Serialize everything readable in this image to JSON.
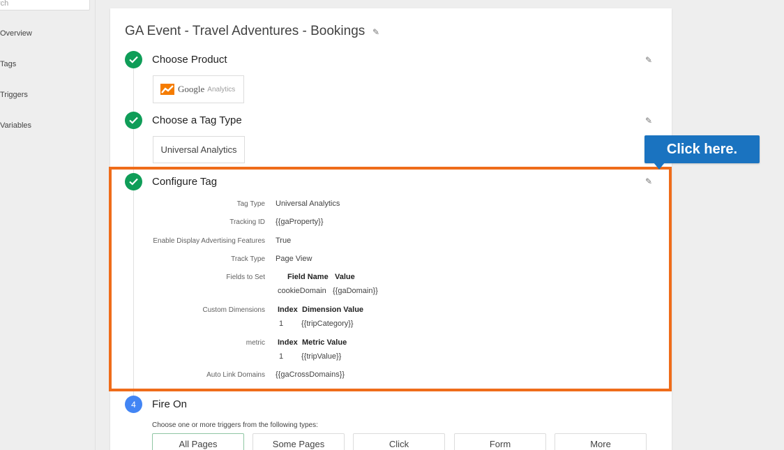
{
  "sidebar": {
    "search_placeholder": "rch",
    "items": [
      {
        "label": "Overview"
      },
      {
        "label": "Tags"
      },
      {
        "label": "Triggers"
      },
      {
        "label": "Variables"
      }
    ]
  },
  "tag": {
    "title": "GA Event - Travel Adventures - Bookings"
  },
  "steps": {
    "choose_product": {
      "label": "Choose Product",
      "product_google": "Google",
      "product_analytics": "Analytics"
    },
    "choose_tag_type": {
      "label": "Choose a Tag Type",
      "value": "Universal Analytics"
    },
    "configure_tag": {
      "label": "Configure Tag",
      "rows": {
        "tag_type": {
          "label": "Tag Type",
          "value": "Universal Analytics"
        },
        "tracking_id": {
          "label": "Tracking ID",
          "value": "{{gaProperty}}"
        },
        "display_ads": {
          "label": "Enable Display Advertising Features",
          "value": "True"
        },
        "track_type": {
          "label": "Track Type",
          "value": "Page View"
        },
        "fields_to_set": {
          "label": "Fields to Set",
          "col1": "Field Name",
          "col2": "Value",
          "row_name": "cookieDomain",
          "row_value": "{{gaDomain}}"
        },
        "custom_dimensions": {
          "label": "Custom Dimensions",
          "col1": "Index",
          "col2": "Dimension Value",
          "row_index": "1",
          "row_value": "{{tripCategory}}"
        },
        "metric": {
          "label": "metric",
          "col1": "Index",
          "col2": "Metric Value",
          "row_index": "1",
          "row_value": "{{tripValue}}"
        },
        "auto_link": {
          "label": "Auto Link Domains",
          "value": "{{gaCrossDomains}}"
        }
      }
    },
    "fire_on": {
      "number": "4",
      "label": "Fire On",
      "hint": "Choose one or more triggers from the following types:",
      "triggers": [
        "All Pages",
        "Some Pages",
        "Click",
        "Form",
        "More"
      ]
    }
  },
  "callout": {
    "text": "Click here."
  },
  "colors": {
    "highlight": "#ef6c1a",
    "callout": "#1a73c0",
    "done": "#0f9d58",
    "step_number": "#4285f4"
  }
}
